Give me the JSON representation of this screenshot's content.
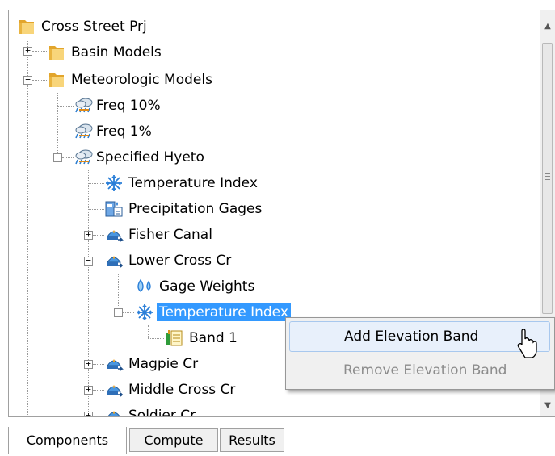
{
  "tree": {
    "nodes": [
      {
        "label": "Cross Street Prj",
        "icon": "folder-icon"
      },
      {
        "label": "Basin Models",
        "icon": "folder-icon"
      },
      {
        "label": "Meteorologic Models",
        "icon": "folder-icon"
      },
      {
        "label": "Freq 10%",
        "icon": "met-model-icon"
      },
      {
        "label": "Freq 1%",
        "icon": "met-model-icon"
      },
      {
        "label": "Specified Hyeto",
        "icon": "met-model-icon"
      },
      {
        "label": "Temperature Index",
        "icon": "snowflake-icon"
      },
      {
        "label": "Precipitation Gages",
        "icon": "precip-gages-icon"
      },
      {
        "label": "Fisher Canal",
        "icon": "subbasin-icon"
      },
      {
        "label": "Lower Cross Cr",
        "icon": "subbasin-icon"
      },
      {
        "label": "Gage Weights",
        "icon": "gage-weights-icon"
      },
      {
        "label": "Temperature Index",
        "icon": "snowflake-icon"
      },
      {
        "label": "Band 1",
        "icon": "elevation-band-icon"
      },
      {
        "label": "Magpie Cr",
        "icon": "subbasin-icon"
      },
      {
        "label": "Middle Cross Cr",
        "icon": "subbasin-icon"
      },
      {
        "label": "Soldier Cr",
        "icon": "subbasin-icon"
      }
    ]
  },
  "context_menu": {
    "items": [
      {
        "label": "Add Elevation Band",
        "enabled": true
      },
      {
        "label": "Remove Elevation Band",
        "enabled": false
      }
    ]
  },
  "tabs": [
    {
      "label": "Components",
      "active": true
    },
    {
      "label": "Compute",
      "active": false
    },
    {
      "label": "Results",
      "active": false
    }
  ],
  "colors": {
    "selection": "#3399ff",
    "menu_background": "#f0f0f0",
    "menu_hot": "#e8f0fb"
  }
}
